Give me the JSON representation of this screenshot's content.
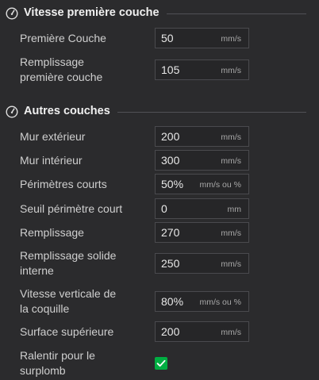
{
  "sections": {
    "first_layer": {
      "title": "Vitesse première couche",
      "icon": "speedometer-icon"
    },
    "other_layers": {
      "title": "Autres couches",
      "icon": "speedometer-icon"
    }
  },
  "fields": {
    "first_layer_speed": {
      "label": "Première Couche",
      "value": "50",
      "unit": "mm/s"
    },
    "first_layer_infill": {
      "label": "Remplissage\npremière couche",
      "value": "105",
      "unit": "mm/s"
    },
    "outer_wall": {
      "label": "Mur extérieur",
      "value": "200",
      "unit": "mm/s"
    },
    "inner_wall": {
      "label": "Mur intérieur",
      "value": "300",
      "unit": "mm/s"
    },
    "small_perimeters": {
      "label": "Périmètres courts",
      "value": "50%",
      "unit": "mm/s ou %"
    },
    "small_perimeter_threshold": {
      "label": "Seuil périmètre court",
      "value": "0",
      "unit": "mm"
    },
    "sparse_infill": {
      "label": "Remplissage",
      "value": "270",
      "unit": "mm/s"
    },
    "internal_solid_infill": {
      "label": "Remplissage solide\ninterne",
      "value": "250",
      "unit": "mm/s"
    },
    "vertical_shell": {
      "label": "Vitesse verticale de\nla coquille",
      "value": "80%",
      "unit": "mm/s ou %"
    },
    "top_surface": {
      "label": "Surface supérieure",
      "value": "200",
      "unit": "mm/s"
    }
  },
  "overhang_slowdown": {
    "label": "Ralentir pour le\nsurplomb",
    "checked": true
  }
}
